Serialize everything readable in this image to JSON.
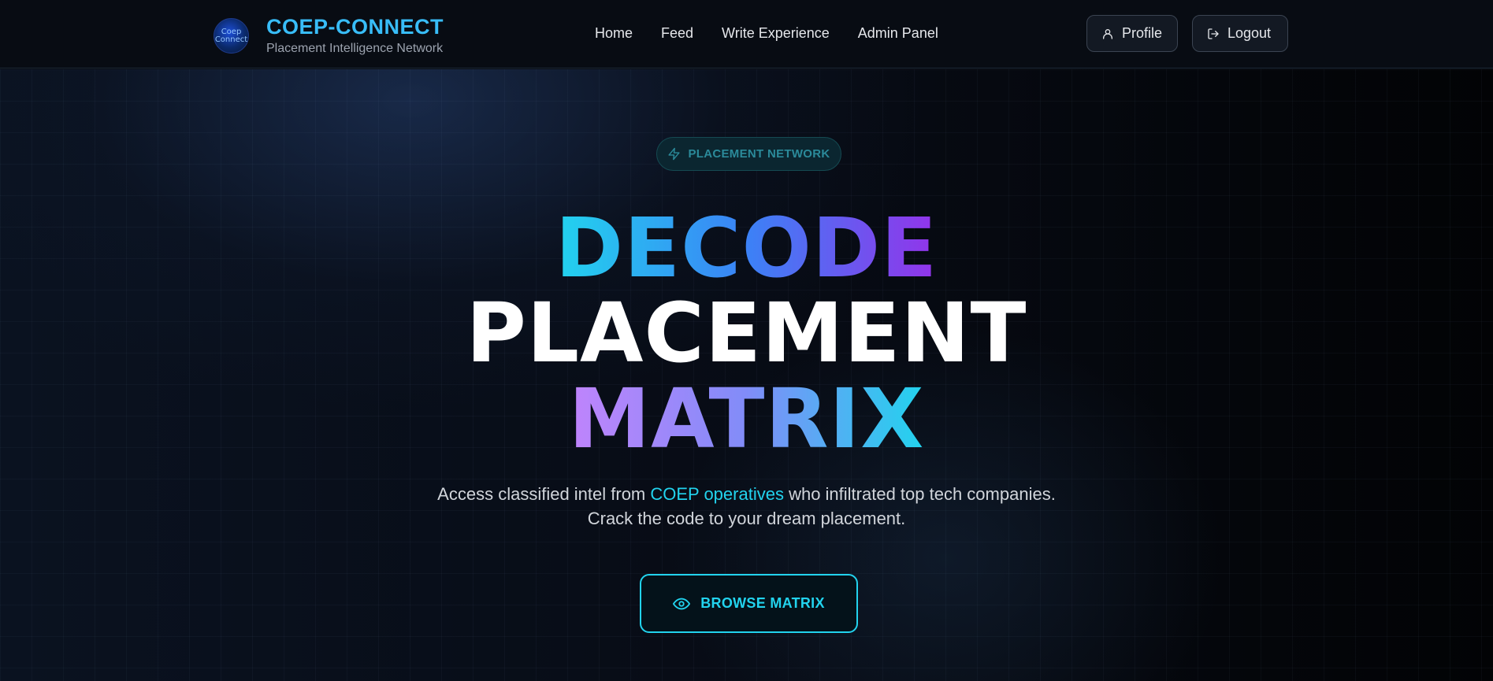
{
  "brand": {
    "logo_line1": "Coep",
    "logo_line2": "Connect",
    "title": "COEP-CONNECT",
    "subtitle": "Placement Intelligence Network"
  },
  "nav": {
    "items": [
      {
        "label": "Home"
      },
      {
        "label": "Feed"
      },
      {
        "label": "Write Experience"
      },
      {
        "label": "Admin Panel"
      }
    ],
    "profile_label": "Profile",
    "logout_label": "Logout"
  },
  "hero": {
    "badge": "PLACEMENT NETWORK",
    "line1": "DECODE",
    "line2": "PLACEMENT",
    "line3": "MATRIX",
    "desc_part1": "Access classified intel from ",
    "desc_highlight": "COEP operatives",
    "desc_part2": " who infiltrated top tech companies.",
    "desc_line2": "Crack the code to your dream placement.",
    "cta_label": "BROWSE MATRIX"
  },
  "colors": {
    "accent_cyan": "#22d3ee",
    "brand_blue": "#38bdf8",
    "accent_purple": "#9333ea"
  },
  "icons": {
    "badge": "lightning-icon",
    "profile": "user-icon",
    "logout": "logout-icon",
    "cta": "eye-icon"
  }
}
